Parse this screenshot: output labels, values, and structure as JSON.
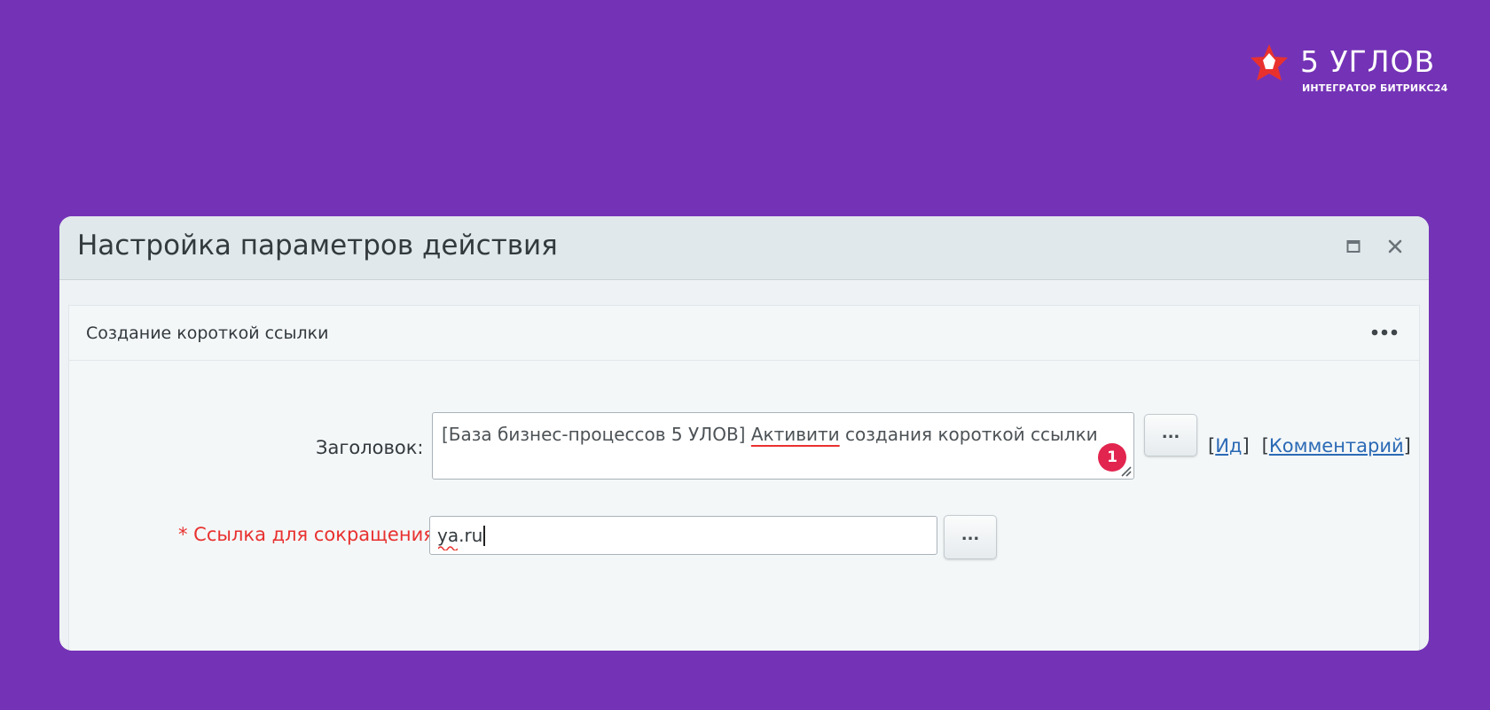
{
  "brand": {
    "name": "5 УГЛОВ",
    "subtitle": "ИНТЕГРАТОР БИТРИКС24"
  },
  "dialog": {
    "title": "Настройка параметров действия",
    "panel_title": "Создание короткой ссылки",
    "fields": {
      "title_label": "Заголовок:",
      "title_value_pre": "[База бизнес-процессов 5 УЛОВ] ",
      "title_value_marked": "Активити",
      "title_value_post": " создания короткой ссылки",
      "title_badge": "1",
      "link_label": "* Ссылка для сокращения:",
      "link_value": "ya.ru"
    },
    "buttons": {
      "dots_label": "..."
    },
    "links": {
      "id": "Ид",
      "comment": "Комментарий",
      "open_bracket": "[",
      "close_bracket": "]"
    }
  },
  "colors": {
    "background": "#7433b6",
    "badge": "#e2254e",
    "required": "#e8312f",
    "link": "#2b6ab5"
  }
}
